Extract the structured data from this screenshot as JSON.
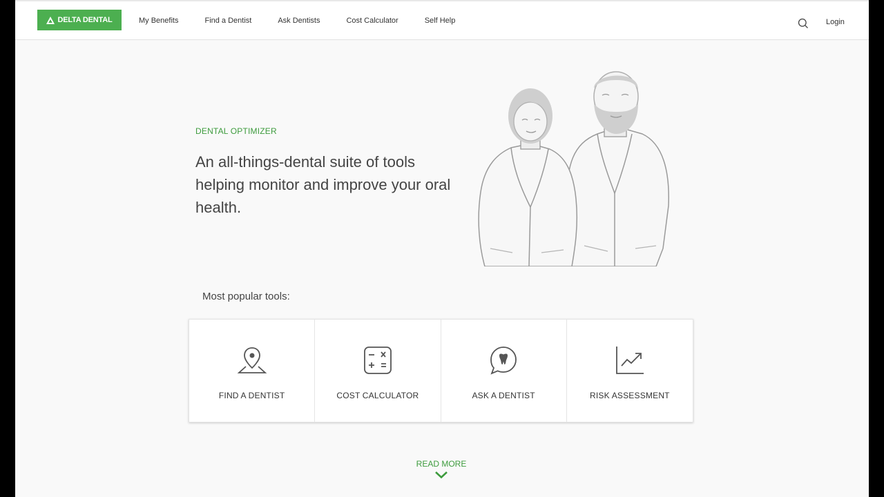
{
  "header": {
    "logo_text": "DELTA DENTAL",
    "nav": [
      {
        "label": "My Benefits"
      },
      {
        "label": "Find a Dentist"
      },
      {
        "label": "Ask Dentists"
      },
      {
        "label": "Cost Calculator"
      },
      {
        "label": "Self Help"
      }
    ],
    "search_icon": "search-icon",
    "login_label": "Login"
  },
  "hero": {
    "eyebrow": "DENTAL OPTIMIZER",
    "headline": "An all-things-dental suite of tools helping monitor and improve your oral health."
  },
  "tools": {
    "heading": "Most popular tools:",
    "items": [
      {
        "label": "FIND A DENTIST",
        "icon": "map-pin-icon"
      },
      {
        "label": "COST CALCULATOR",
        "icon": "calculator-icon"
      },
      {
        "label": "ASK A DENTIST",
        "icon": "tooth-chat-icon"
      },
      {
        "label": "RISK ASSESSMENT",
        "icon": "trend-chart-icon"
      }
    ]
  },
  "read_more": {
    "label": "READ MORE",
    "icon": "chevron-down-icon"
  },
  "colors": {
    "brand_green": "#4caf50",
    "accent_green": "#3d9b3d",
    "text": "#444444"
  }
}
